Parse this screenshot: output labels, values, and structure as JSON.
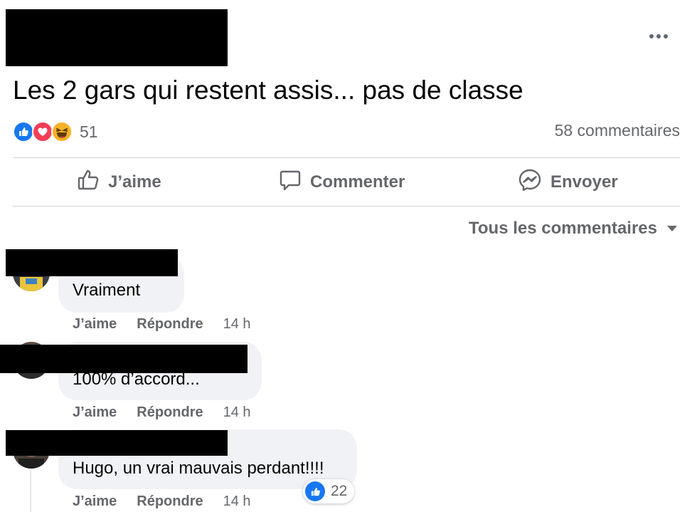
{
  "post": {
    "text": "Les 2 gars qui restent assis... pas de classe",
    "reaction_count": "51",
    "comments_count": "58 commentaires",
    "reaction_icons": [
      "like-icon",
      "love-icon",
      "haha-icon"
    ]
  },
  "actions": {
    "like": "J’aime",
    "comment": "Commenter",
    "send": "Envoyer"
  },
  "filter": {
    "label": "Tous les commentaires"
  },
  "comments": [
    {
      "text": "Vraiment",
      "like": "J’aime",
      "reply": "Répondre",
      "time": "14 h"
    },
    {
      "text": "100% d’accord...",
      "like": "J’aime",
      "reply": "Répondre",
      "time": "14 h"
    },
    {
      "text": "Hugo, un vrai mauvais perdant!!!!",
      "like": "J’aime",
      "reply": "Répondre",
      "time": "14 h",
      "likes": "22"
    }
  ],
  "colors": {
    "brand_blue": "#1877f2",
    "love_red": "#f33e58",
    "haha_yellow": "#f7b125",
    "muted_text": "#65676b",
    "bubble_bg": "#f0f2f5"
  }
}
